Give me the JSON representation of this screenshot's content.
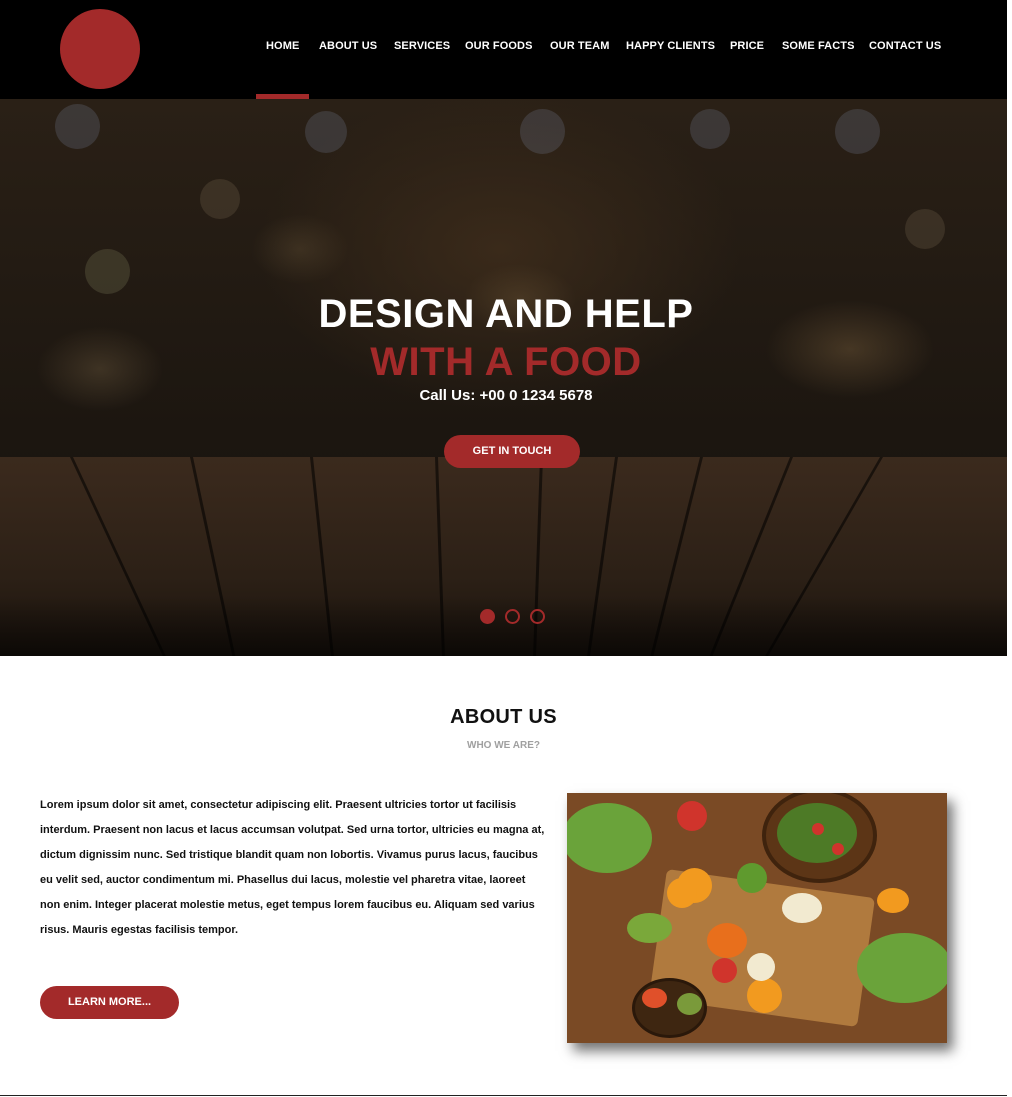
{
  "nav": {
    "items": [
      {
        "label": "HOME",
        "active": true
      },
      {
        "label": "ABOUT US"
      },
      {
        "label": "SERVICES"
      },
      {
        "label": "OUR FOODS"
      },
      {
        "label": "OUR TEAM"
      },
      {
        "label": "HAPPY CLIENTS"
      },
      {
        "label": "PRICE"
      },
      {
        "label": "SOME FACTS"
      },
      {
        "label": "CONTACT US"
      }
    ]
  },
  "hero": {
    "title_line1": "DESIGN AND HELP",
    "title_line2": "WITH A FOOD",
    "call": "Call Us: +00 0 1234 5678",
    "button": "GET IN TOUCH",
    "slides": 3,
    "active_slide": 1
  },
  "about": {
    "title": "ABOUT US",
    "subtitle": "WHO WE ARE?",
    "body_lines": [
      "Lorem ipsum dolor sit amet, consectetur adipiscing elit. Praesent ultricies tortor ut facilisis",
      "interdum. Praesent non lacus et lacus accumsan volutpat. Sed urna tortor, ultricies eu magna at,",
      "dictum dignissim nunc. Sed tristique blandit quam non lobortis. Vivamus purus lacus, faucibus",
      "eu velit sed, auctor condimentum mi. Phasellus dui lacus, molestie vel pharetra vitae, laoreet",
      "non enim. Integer placerat molestie metus, eget tempus lorem faucibus eu. Aliquam sed varius",
      "risus. Mauris egestas facilisis tempor."
    ],
    "button": "LEARN MORE..."
  },
  "colors": {
    "accent": "#a32a2a",
    "header_bg": "#000000"
  }
}
